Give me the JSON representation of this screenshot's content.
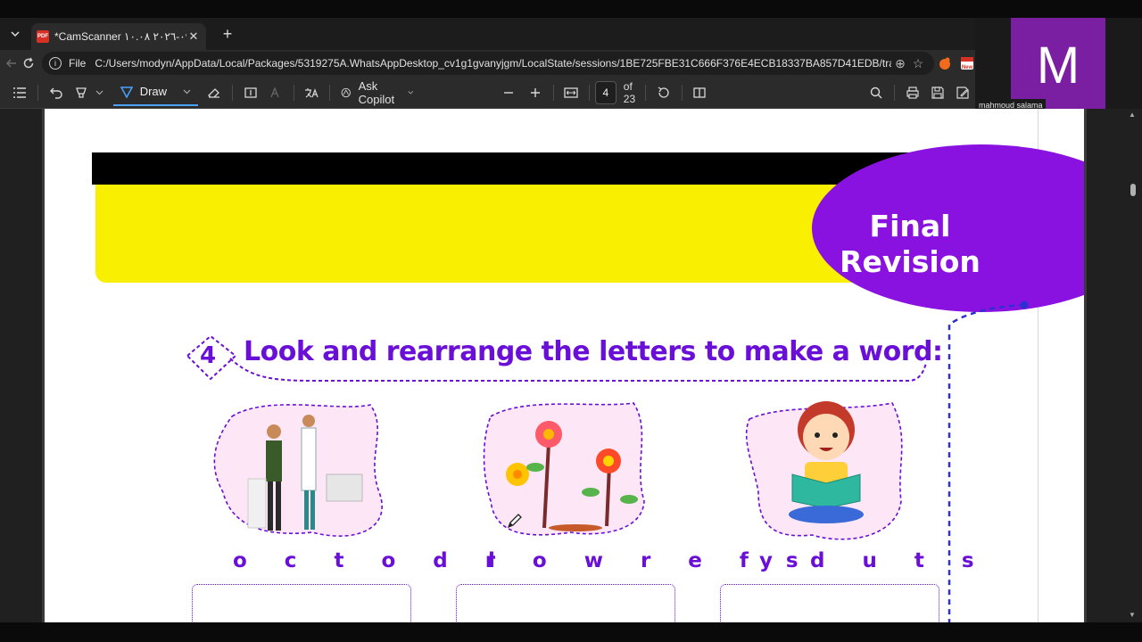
{
  "browser": {
    "tab": {
      "title": "*CamScanner ٠٤-٠٩-٢٠٢٦ ١٠.٠٨",
      "icon": "pdf-icon",
      "icon_label": "PDF"
    },
    "address": {
      "scheme": "File",
      "url": "C:/Users/modyn/AppData/Local/Packages/5319275A.WhatsAppDesktop_cv1g1gvanyjgm/LocalState/sessions/1BE725FBE31C666F376E4ECB18337BA857D41EDB/trans..."
    },
    "extension_badge": "New"
  },
  "pdf_toolbar": {
    "draw_label": "Draw",
    "copilot_label": "Ask Copilot",
    "page_current": "4",
    "page_total": "of 23"
  },
  "webcam": {
    "initial": "M",
    "name": "mahmoud salama",
    "color": "#7b1fa2"
  },
  "document": {
    "badge_line1": "Final",
    "badge_line2": "Revision",
    "exercise_number": "4",
    "instruction": "Look and rearrange the letters to make a word:",
    "items": [
      {
        "letters": "o c t o d r",
        "image": "doctor-and-patient"
      },
      {
        "letters": "l o w r e f s",
        "image": "flowers"
      },
      {
        "letters": "y d u t s",
        "image": "child-reading-book"
      }
    ],
    "accent_color": "#6a0fd8",
    "banner_yellow": "#f8f000",
    "badge_purple": "#8a12e0"
  }
}
